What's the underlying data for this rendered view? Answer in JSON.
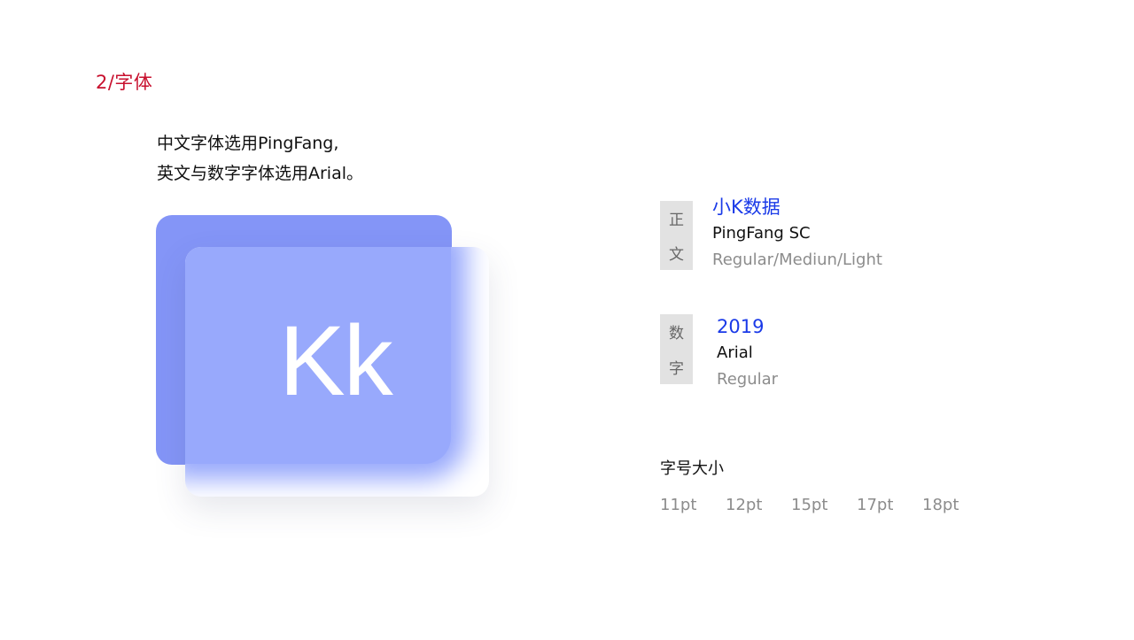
{
  "section": {
    "title": "2/字体"
  },
  "intro": {
    "line1": "中文字体选用PingFang,",
    "line2": "英文与数字字体选用Arial。"
  },
  "illustration": {
    "letters": "Kk",
    "back_color": "#8495f7",
    "front_color": "#98a9fc"
  },
  "body_font": {
    "tag_chars": [
      "正",
      "文"
    ],
    "sample": "小K数据",
    "name": "PingFang SC",
    "weights": "Regular/Mediun/Light"
  },
  "digit_font": {
    "tag_chars": [
      "数",
      "字"
    ],
    "sample": "2019",
    "name": "Arial",
    "weights": "Regular"
  },
  "font_sizes": {
    "heading": "字号大小",
    "sizes": [
      "11pt",
      "12pt",
      "15pt",
      "17pt",
      "18pt"
    ]
  },
  "colors": {
    "accent_red": "#c8102e",
    "accent_blue": "#1a3ae8",
    "muted_gray": "#8c8c8c"
  }
}
